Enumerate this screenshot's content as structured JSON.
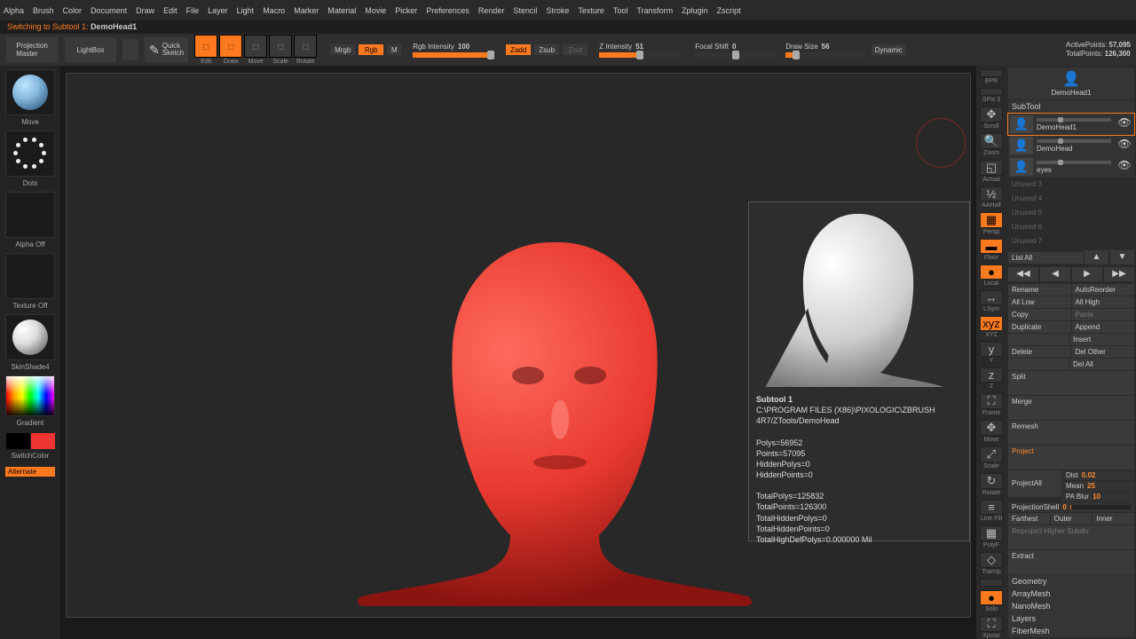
{
  "menu": [
    "Alpha",
    "Brush",
    "Color",
    "Document",
    "Draw",
    "Edit",
    "File",
    "Layer",
    "Light",
    "Macro",
    "Marker",
    "Material",
    "Movie",
    "Picker",
    "Preferences",
    "Render",
    "Stencil",
    "Stroke",
    "Texture",
    "Tool",
    "Transform",
    "Zplugin",
    "Zscript"
  ],
  "status": {
    "prefix": "Switching to Subtool 1:  ",
    "subtool": "DemoHead1"
  },
  "toolrow": {
    "projection_master": "Projection\nMaster",
    "lightbox": "LightBox",
    "quicksketch": "Quick\nSketch",
    "icons": [
      {
        "name": "edit",
        "lbl": "Edit",
        "on": true
      },
      {
        "name": "draw",
        "lbl": "Draw",
        "on": true
      },
      {
        "name": "move",
        "lbl": "Move",
        "on": false
      },
      {
        "name": "scale",
        "lbl": "Scale",
        "on": false
      },
      {
        "name": "rotate",
        "lbl": "Rotate",
        "on": false
      }
    ],
    "mrgb": "Mrgb",
    "rgb": "Rgb",
    "m": "M",
    "rgb_intensity_label": "Rgb Intensity",
    "rgb_intensity_val": "100",
    "zadd": "Zadd",
    "zsub": "Zsub",
    "zcut": "Zcut",
    "z_intensity_label": "Z Intensity",
    "z_intensity_val": "51",
    "focal_label": "Focal Shift",
    "focal_val": "0",
    "draw_label": "Draw Size",
    "draw_val": "56",
    "dynamic": "Dynamic",
    "active_label": "ActivePoints:",
    "active_val": "57,095",
    "total_label": "TotalPoints:",
    "total_val": "126,300"
  },
  "left": {
    "move": "Move",
    "dots": "Dots",
    "alpha": "Alpha Off",
    "texture": "Texture Off",
    "material": "SkinShade4",
    "gradient": "Gradient",
    "switch": "SwitchColor",
    "alternate": "Alternate"
  },
  "rightnav": [
    {
      "n": "bpr",
      "l": "BPR",
      "o": false
    },
    {
      "n": "spix",
      "l": "SPix 3",
      "cap": true
    },
    {
      "n": "scroll",
      "l": "Scroll",
      "g": "✥"
    },
    {
      "n": "zoom",
      "l": "Zoom",
      "g": "🔍"
    },
    {
      "n": "actual",
      "l": "Actual",
      "g": "◱"
    },
    {
      "n": "aahalf",
      "l": "AAHalf",
      "g": "½"
    },
    {
      "n": "persp",
      "l": "Persp",
      "o": true,
      "g": "▦"
    },
    {
      "n": "floor",
      "l": "Floor",
      "o": true,
      "g": "▬"
    },
    {
      "n": "local",
      "l": "Local",
      "o": true,
      "g": "●"
    },
    {
      "n": "lsym",
      "l": "LSym",
      "g": "↔"
    },
    {
      "n": "xyz",
      "l": "XYZ",
      "o": true,
      "g": "xyz"
    },
    {
      "n": "y",
      "l": "Y",
      "g": "y"
    },
    {
      "n": "z",
      "l": "Z",
      "g": "z"
    },
    {
      "n": "frame",
      "l": "Frame",
      "g": "⛶"
    },
    {
      "n": "move2",
      "l": "Move",
      "g": "✥"
    },
    {
      "n": "scale2",
      "l": "Scale",
      "g": "⤢"
    },
    {
      "n": "rotate2",
      "l": "Rotate",
      "g": "↻"
    },
    {
      "n": "linefill",
      "l": "Line Fill",
      "g": "≡"
    },
    {
      "n": "polyf",
      "l": "PolyF",
      "g": "▦"
    },
    {
      "n": "transp",
      "l": "Transp",
      "g": "◇"
    },
    {
      "n": "ghost",
      "l": "",
      "g": ""
    },
    {
      "n": "solo",
      "l": "Solo",
      "o": true,
      "g": "●"
    },
    {
      "n": "xpose",
      "l": "Xpose",
      "g": "⛶"
    }
  ],
  "info": {
    "title": "Subtool 1",
    "path": "C:\\PROGRAM FILES (X86)\\PIXOLOGIC\\ZBRUSH 4R7/ZTools/DemoHead",
    "polys": "Polys=56952",
    "points": "Points=57095",
    "hpolys": "HiddenPolys=0",
    "hpoints": "HiddenPoints=0",
    "tpolys": "TotalPolys=125832",
    "tpoints": "TotalPoints=126300",
    "thpolys": "TotalHiddenPolys=0",
    "thpoints": "TotalHiddenPoints=0",
    "thd": "TotalHighDefPolys=0.000000 Mil"
  },
  "rpanel": {
    "tool_name": "DemoHead1",
    "section": "SubTool",
    "subtools": [
      {
        "name": "DemoHead1",
        "sel": true
      },
      {
        "name": "DemoHead",
        "sel": false
      },
      {
        "name": "eyes",
        "sel": false
      }
    ],
    "unused": [
      "Unused 3",
      "Unused 4",
      "Unused 5",
      "Unused 6",
      "Unused 7"
    ],
    "list_all": "List All",
    "buttons": {
      "rename": "Rename",
      "auto": "AutoReorder",
      "alllow": "All Low",
      "allhigh": "All High",
      "copy": "Copy",
      "paste": "Paste",
      "dup": "Duplicate",
      "append": "Append",
      "insert": "Insert",
      "del": "Delete",
      "delother": "Del Other",
      "delall": "Del All",
      "split": "Split",
      "merge": "Merge",
      "remesh": "Remesh",
      "project": "Project",
      "projectall": "ProjectAll",
      "dist": "Dist",
      "dist_v": "0.02",
      "mean": "Mean",
      "mean_v": "25",
      "pablur": "PA Blur",
      "pablur_v": "10",
      "projshell": "ProjectionShell",
      "projshell_v": "0",
      "farthest": "Farthest",
      "outer": "Outer",
      "inner": "Inner",
      "reproj": "Reproject Higher Subdiv",
      "extract": "Extract"
    },
    "subs": [
      "Geometry",
      "ArrayMesh",
      "NanoMesh",
      "Layers",
      "FiberMesh"
    ]
  }
}
